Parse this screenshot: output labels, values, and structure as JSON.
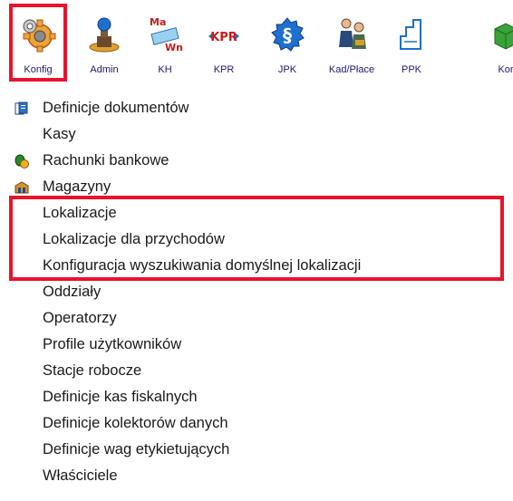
{
  "toolbar": {
    "buttons": [
      {
        "label": "Konfig",
        "icon": "config-gear-icon"
      },
      {
        "label": "Admin",
        "icon": "admin-stamp-icon"
      },
      {
        "label": "KH",
        "icon": "ma-wn-ledger-icon"
      },
      {
        "label": "KPR",
        "icon": "kpr-arrows-icon"
      },
      {
        "label": "JPK",
        "icon": "jpk-paragraph-icon"
      },
      {
        "label": "Kad/Płace",
        "icon": "staff-payroll-icon"
      },
      {
        "label": "PPK",
        "icon": "ppk-chart-icon"
      },
      {
        "label": "Kor",
        "icon": "green-cube-icon"
      }
    ],
    "ma_text": "Ma",
    "wn_text": "Wn",
    "kpr_text": "KPR",
    "jpk_text": "§"
  },
  "menu": {
    "items": [
      {
        "label": "Definicje dokumentów",
        "icon": "documents-icon"
      },
      {
        "label": "Kasy"
      },
      {
        "label": "Rachunki bankowe",
        "icon": "bank-money-icon"
      },
      {
        "label": "Magazyny",
        "icon": "warehouse-icon"
      },
      {
        "label": "Lokalizacje"
      },
      {
        "label": "Lokalizacje dla przychodów"
      },
      {
        "label": "Konfiguracja wyszukiwania domyślnej lokalizacji"
      },
      {
        "label": "Oddziały"
      },
      {
        "label": "Operatorzy"
      },
      {
        "label": "Profile użytkowników"
      },
      {
        "label": "Stacje robocze"
      },
      {
        "label": "Definicje kas fiskalnych"
      },
      {
        "label": "Definicje kolektorów danych"
      },
      {
        "label": "Definicje wag etykietujących"
      },
      {
        "label": "Właściciele"
      }
    ]
  },
  "colors": {
    "highlight": "#e8132b",
    "label_text": "#1a1a6e"
  }
}
